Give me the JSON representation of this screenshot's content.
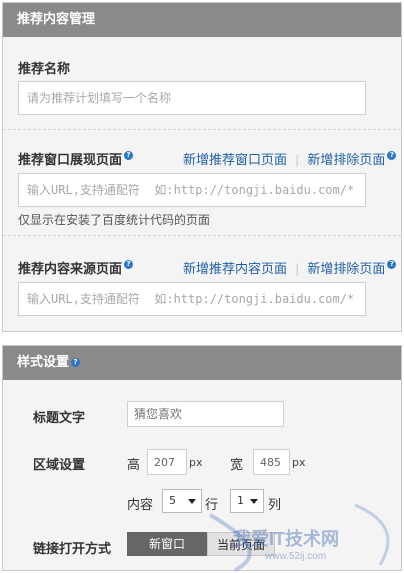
{
  "panel1": {
    "title": "推荐内容管理",
    "name_label": "推荐名称",
    "name_placeholder": "请为推荐计划填写一个名称",
    "window_label": "推荐窗口展现页面",
    "add_window_page": "新增推荐窗口页面",
    "add_exclude_page_1": "新增排除页面",
    "url_placeholder_1": "输入URL,支持通配符  如:http://tongji.baidu.com/*",
    "note": "仅显示在安装了百度统计代码的页面",
    "source_label": "推荐内容来源页面",
    "add_content_page": "新增推荐内容页面",
    "add_exclude_page_2": "新增排除页面",
    "url_placeholder_2": "输入URL,支持通配符  如:http://tongji.baidu.com/*",
    "separator": "|"
  },
  "panel2": {
    "title": "样式设置",
    "title_text_label": "标题文字",
    "title_text_placeholder": "猜您喜欢",
    "area_label": "区域设置",
    "height_label": "高",
    "height_value": "207",
    "width_label": "宽",
    "width_value": "485",
    "unit": "px",
    "content_label": "内容",
    "rows_value": "5",
    "rows_unit": "行",
    "cols_value": "1",
    "cols_unit": "列",
    "link_label": "链接打开方式",
    "option_new": "新窗口",
    "option_current": "当前页面"
  },
  "watermark": {
    "text": "我爱IT技术网",
    "url": "www.52ij.com"
  },
  "colors": {
    "header": "#8a8a8a",
    "link": "#1f5fa8",
    "panel_bg": "#f4f4f4",
    "toggle_active": "#666666"
  },
  "icons": {
    "help": "question-circle-icon",
    "dropdown": "caret-down-icon"
  }
}
